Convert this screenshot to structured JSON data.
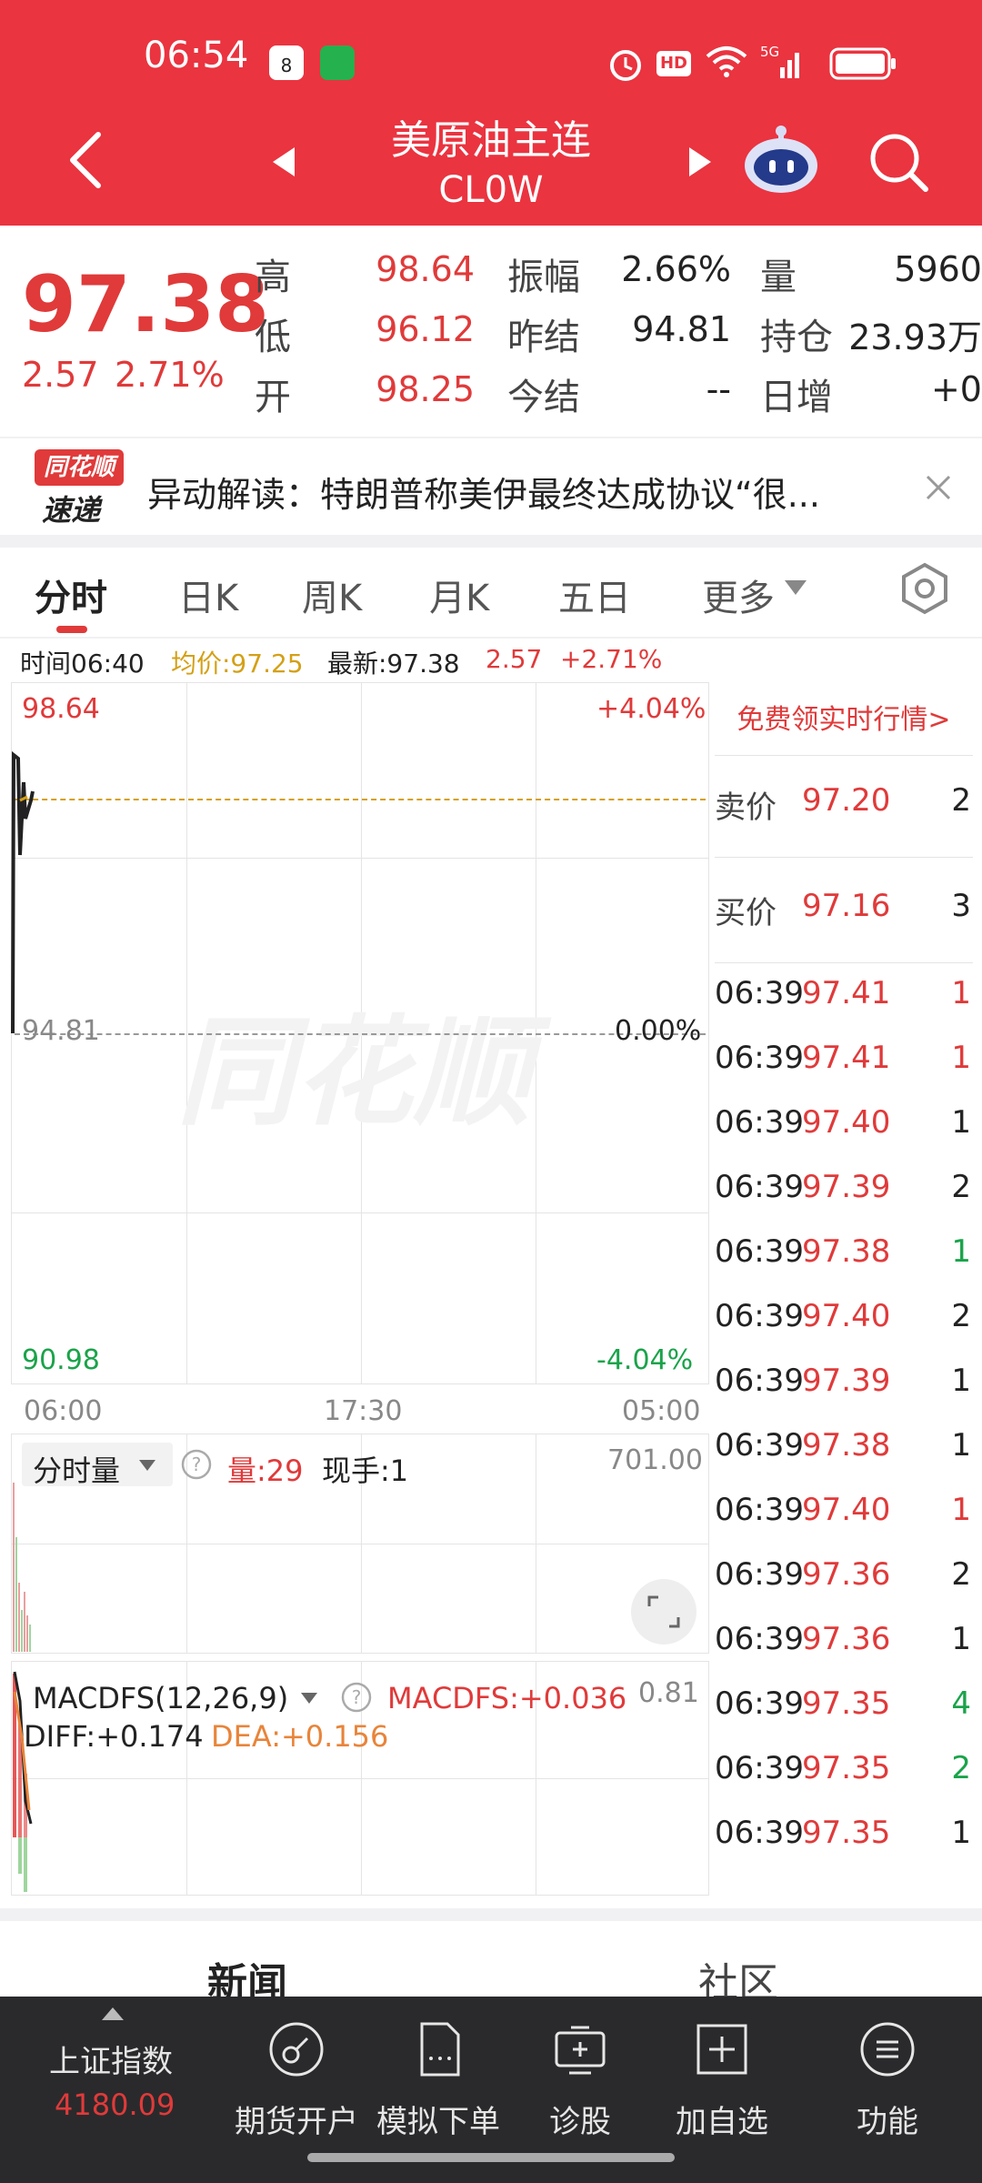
{
  "status_bar": {
    "time": "06:54",
    "badge": "8",
    "right": "HD 5G"
  },
  "header": {
    "title": "美原油主连",
    "subtitle": "CL0W"
  },
  "quote": {
    "last_price": "97.38",
    "change": "2.57",
    "change_pct": "2.71%",
    "high_label": "高",
    "high": "98.64",
    "low_label": "低",
    "low": "96.12",
    "open_label": "开",
    "open": "98.25",
    "amplitude_label": "振幅",
    "amplitude": "2.66%",
    "prev_settle_label": "昨结",
    "prev_settle": "94.81",
    "today_settle_label": "今结",
    "today_settle": "--",
    "volume_label": "量",
    "volume": "5960",
    "open_interest_label": "持仓",
    "open_interest": "23.93万",
    "daily_increase_label": "日增",
    "daily_increase": "+0"
  },
  "banner": {
    "brand_top": "同花顺",
    "brand_bottom": "速递",
    "text": "异动解读：特朗普称美伊最终达成协议“很..."
  },
  "tabs": [
    "分时",
    "日K",
    "周K",
    "月K",
    "五日",
    "更多"
  ],
  "chart_info": {
    "time": "时间06:40",
    "avg": "均价:97.25",
    "latest": "最新:97.38",
    "chg": "2.57",
    "pct": "+2.71%"
  },
  "chart": {
    "top_price": "98.64",
    "top_pct": "+4.04%",
    "mid_price": "94.81",
    "mid_pct": "0.00%",
    "bottom_price": "90.98",
    "bottom_pct": "-4.04%",
    "watermark": "同花顺",
    "x_start": "06:00",
    "x_mid": "17:30",
    "x_end": "05:00"
  },
  "volume_panel": {
    "selector": "分时量",
    "volume": "量:29",
    "hand": "现手:1",
    "max": "701.00"
  },
  "macd_panel": {
    "selector": "MACDFS(12,26,9)",
    "macd": "MACDFS:+0.036",
    "max": "0.81",
    "diff": "DIFF:+0.174",
    "dea": "DEA:+0.156"
  },
  "order_book": {
    "promo": "免费领实时行情>",
    "ask_label": "卖价",
    "ask_price": "97.20",
    "ask_vol": "2",
    "bid_label": "买价",
    "bid_price": "97.16",
    "bid_vol": "3",
    "trades": [
      {
        "time": "06:39",
        "price": "97.41",
        "vol": "1",
        "color": "red"
      },
      {
        "time": "06:39",
        "price": "97.41",
        "vol": "1",
        "color": "red"
      },
      {
        "time": "06:39",
        "price": "97.40",
        "vol": "1",
        "color": "dark"
      },
      {
        "time": "06:39",
        "price": "97.39",
        "vol": "2",
        "color": "dark"
      },
      {
        "time": "06:39",
        "price": "97.38",
        "vol": "1",
        "color": "green"
      },
      {
        "time": "06:39",
        "price": "97.40",
        "vol": "2",
        "color": "dark"
      },
      {
        "time": "06:39",
        "price": "97.39",
        "vol": "1",
        "color": "dark"
      },
      {
        "time": "06:39",
        "price": "97.38",
        "vol": "1",
        "color": "dark"
      },
      {
        "time": "06:39",
        "price": "97.40",
        "vol": "1",
        "color": "red"
      },
      {
        "time": "06:39",
        "price": "97.36",
        "vol": "2",
        "color": "dark"
      },
      {
        "time": "06:39",
        "price": "97.36",
        "vol": "1",
        "color": "dark"
      },
      {
        "time": "06:39",
        "price": "97.35",
        "vol": "4",
        "color": "green"
      },
      {
        "time": "06:39",
        "price": "97.35",
        "vol": "2",
        "color": "green"
      },
      {
        "time": "06:39",
        "price": "97.35",
        "vol": "1",
        "color": "dark"
      }
    ]
  },
  "section_tabs": [
    "新闻",
    "社区"
  ],
  "bottom_nav": {
    "index_name": "上证指数",
    "index_value": "4180.09",
    "items": [
      "期货开户",
      "模拟下单",
      "诊股",
      "加自选",
      "功能"
    ]
  },
  "colors": {
    "brand_red": "#ea3440",
    "up_red": "#e03a3a",
    "down_green": "#1aa34a",
    "avg_yellow": "#d4a017",
    "dea_orange": "#e8843a",
    "nav_bg": "#2a2a2c"
  }
}
